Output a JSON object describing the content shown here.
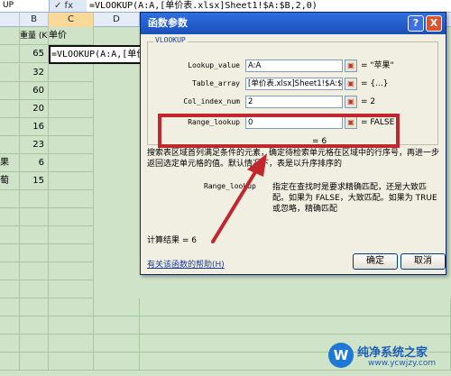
{
  "formula_bar": {
    "name_box": "UP",
    "icons": "✓ fx",
    "formula": "=VLOOKUP(A:A,[单价表.xlsx]Sheet1!$A:$B,2,0)"
  },
  "columns": [
    "B",
    "C",
    "D"
  ],
  "sheet": {
    "header_b": "重量 (KG)",
    "header_c": "单价",
    "active_cell_text": "=VLOOKUP(A:A,[单价表.xl",
    "values": [
      "65",
      "32",
      "60",
      "20",
      "16",
      "23",
      "6",
      "15"
    ],
    "left_edge_chars": [
      "果",
      "萄"
    ]
  },
  "dialog": {
    "title": "函数参数",
    "help_button": "?",
    "close_button": "X",
    "group_label": "VLOOKUP",
    "args": [
      {
        "label": "Lookup_value",
        "value": "A:A",
        "result": "= \"苹果\""
      },
      {
        "label": "Table_array",
        "value": "[单价表.xlsx]Sheet1!$A:$B",
        "result": "= {...}"
      },
      {
        "label": "Col_index_num",
        "value": "2",
        "result": "= 2"
      },
      {
        "label": "Range_lookup",
        "value": "0",
        "result": "= FALSE"
      }
    ],
    "overall_result": "= 6",
    "description": "搜索表区域首列满足条件的元素，确定待检索单元格在区域中的行序号，再进一步返回选定单元格的值。默认情况下，表是以升序排序的",
    "param_desc_label": "Range_lookup",
    "param_desc_text": "指定在查找时是要求精确匹配，还是大致匹配。如果为 FALSE，大致匹配。如果为 TRUE 或忽略，精确匹配",
    "calc_result": "计算结果 = 6",
    "help_link": "有关该函数的帮助(H)",
    "ok_label": "确定",
    "cancel_label": "取消"
  },
  "watermark": {
    "logo": "W",
    "title": "纯净系统之家",
    "url": "www.ycwjzy.com"
  },
  "colors": {
    "sheet_bg": "#cfe3c8",
    "titlebar": "#2f6fe3",
    "annotation": "#c1272d"
  }
}
